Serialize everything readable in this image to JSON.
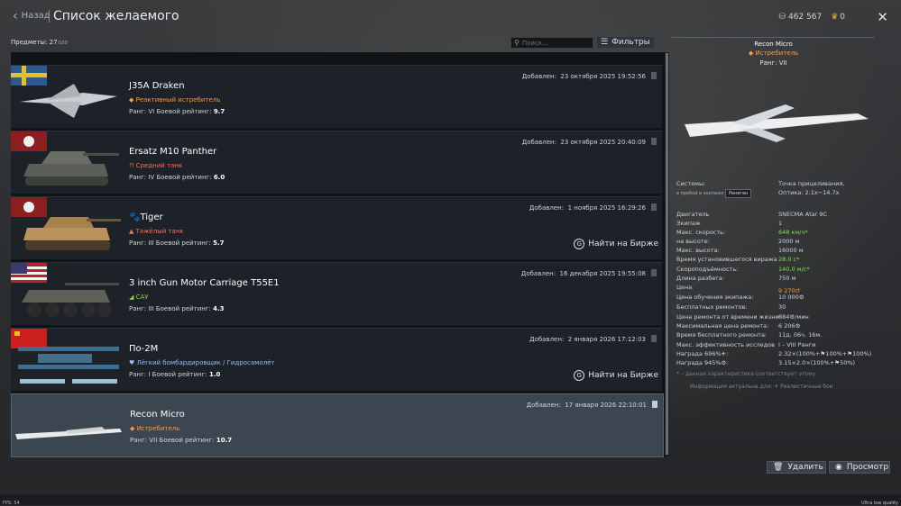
{
  "header": {
    "back_label": "Назад",
    "title": "Список желаемого",
    "silver": "462 567",
    "gold": "0"
  },
  "toolbar": {
    "counter_label": "Предметы:",
    "counter_value": "27",
    "counter_max": "/100",
    "search_placeholder": "Поиск...",
    "filters_label": "Фильтры"
  },
  "items": [
    {
      "name": "J35A Draken",
      "type": "◆ Реактивный истребитель",
      "type_color": "#ff9933",
      "rank": "VI",
      "br": "9.7",
      "added": "23 октября 2025 19:52:56",
      "market": ""
    },
    {
      "name": "Ersatz M10 Panther",
      "type": "⊓ Средний танк",
      "type_color": "#ff6b5b",
      "rank": "IV",
      "br": "6.0",
      "added": "23 октября 2025 20:40:09",
      "market": ""
    },
    {
      "name": "🐾Tiger",
      "type": "▲ Тяжёлый танк",
      "type_color": "#ff6b5b",
      "rank": "III",
      "br": "5.7",
      "added": "1 ноября 2025 16:29:26",
      "market": "Найти на Бирже"
    },
    {
      "name": "3 inch Gun Motor Carriage T55E1",
      "type": "◢ САУ",
      "type_color": "#8fd14f",
      "rank": "III",
      "br": "4.3",
      "added": "16 декабря 2025 19:55:08",
      "market": ""
    },
    {
      "name": "По-2М",
      "type": "♥ Лёгкий бомбардировщик / Гидросамолёт",
      "type_color": "#9bb8ff",
      "rank": "I",
      "br": "1.0",
      "added": "2 января 2026 17:12:03",
      "market": "Найти на Бирже"
    },
    {
      "name": "Recon Micro",
      "type": "◆ Истребитель",
      "type_color": "#ff9933",
      "rank": "VII",
      "br": "10.7",
      "added": "17 января 2026 22:10:01",
      "market": ""
    }
  ],
  "labels": {
    "added_prefix": "Добавлен:",
    "rank_prefix": "Ранг:",
    "br_prefix": "Боевой рейтинг:"
  },
  "detail": {
    "name": "Recon Micro",
    "type": "◆ Истребитель",
    "rank": "Ранг: VII",
    "systems_label": "Системы:",
    "systems_value_1": "Точка прицеливания,",
    "systems_value_2": "Оптика: 2.1x−14.7x",
    "pilot_prefix": "в пребой в экипаже",
    "pilot_name": "Ренеген",
    "stats": [
      {
        "k": "Двигатель",
        "v": "SNECMA Atar 9C",
        "c": ""
      },
      {
        "k": "Экипаж",
        "v": "1",
        "c": ""
      },
      {
        "k": "Макс. скорость:",
        "v": "648 км/ч*",
        "c": "gr"
      },
      {
        "k": "на высоте:",
        "v": "2000 м",
        "c": ""
      },
      {
        "k": "Макс. высота:",
        "v": "16000 м",
        "c": ""
      },
      {
        "k": "Время установившегося виража",
        "v": "28.0 с*",
        "c": "gr"
      },
      {
        "k": "Скороподъёмность:",
        "v": "140.0 м/с*",
        "c": "gr"
      },
      {
        "k": "Длина разбега:",
        "v": "750 м",
        "c": ""
      },
      {
        "k": "Цена",
        "v": "9 270🜚",
        "c": "or"
      },
      {
        "k": "Цена обучения экипажа:",
        "v": "10 000⚙",
        "c": ""
      },
      {
        "k": "Бесплатных ремонтов:",
        "v": "30",
        "c": ""
      },
      {
        "k": "Цена ремонта от времени жизни",
        "v": "884⚙/мин",
        "c": ""
      },
      {
        "k": "Максимальная цена ремонта:",
        "v": "6 206⚙",
        "c": ""
      },
      {
        "k": "Время бесплатного ремонта:",
        "v": "11д. 06ч. 16м.",
        "c": ""
      },
      {
        "k": "Макс. эффективность исследов",
        "v": "I – VIII Ранги",
        "c": ""
      },
      {
        "k": "Награда 696%✈:",
        "v": "2.32×(100%+⚑100%+⚑100%)",
        "c": ""
      },
      {
        "k": "Награда 945%⚙:",
        "v": "3.15×2.0×(100%+⚑50%)",
        "c": ""
      }
    ],
    "note": "* – данная характеристика соответствует этому",
    "info_label": "Информация актуальна для: ✈ Реалистичные бои"
  },
  "buttons": {
    "delete_label": "Удалить",
    "view_label": "Просмотр"
  },
  "footer": {
    "fps": "FPS: 54",
    "quality": "Ultra low quality"
  }
}
